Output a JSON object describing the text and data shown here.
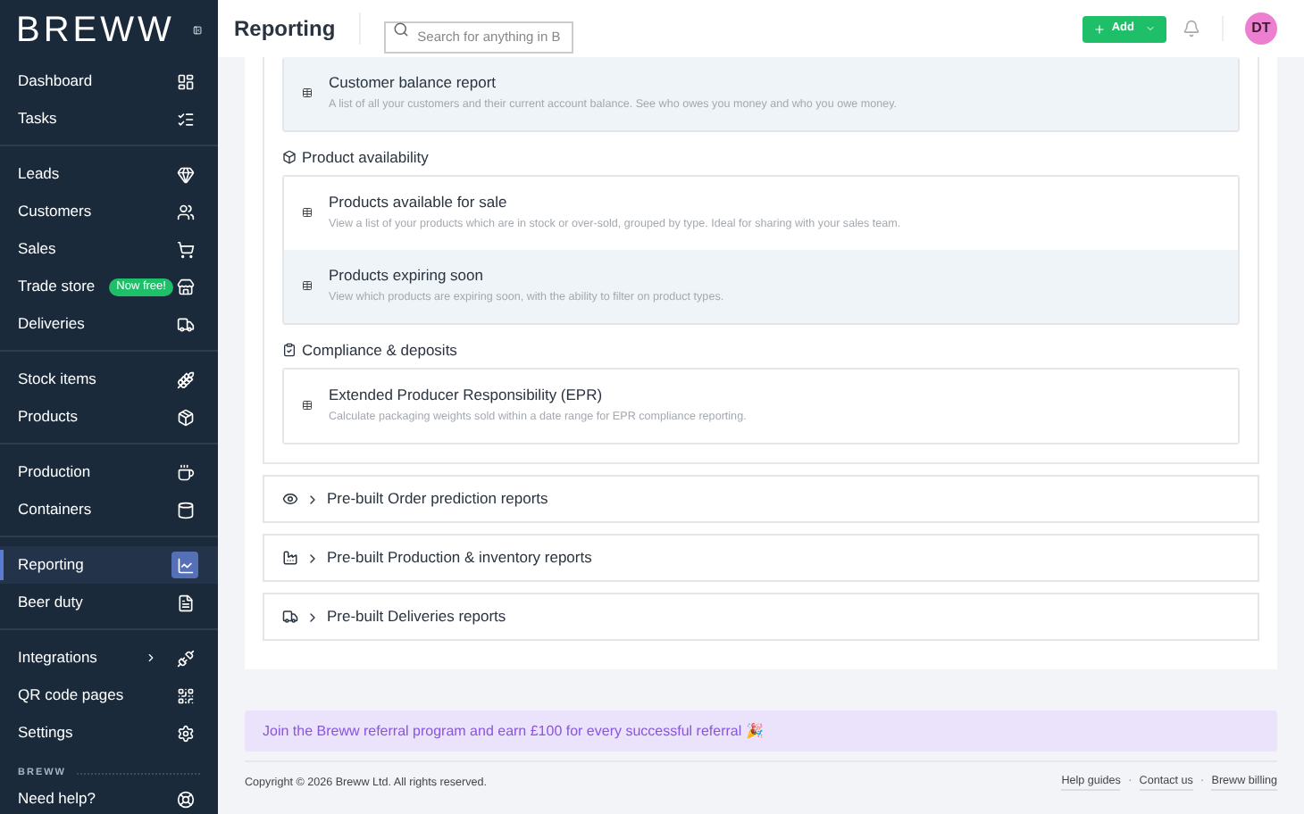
{
  "sidebar": {
    "logo": "BREWW",
    "groups": [
      [
        {
          "label": "Dashboard",
          "selected": false
        },
        {
          "label": "Tasks",
          "selected": false
        }
      ],
      [
        {
          "label": "Leads",
          "selected": false
        },
        {
          "label": "Customers",
          "selected": false
        },
        {
          "label": "Sales",
          "selected": false
        },
        {
          "label": "Trade store",
          "badge": "Now free!",
          "selected": false
        },
        {
          "label": "Deliveries",
          "selected": false
        }
      ],
      [
        {
          "label": "Stock items",
          "selected": false
        },
        {
          "label": "Products",
          "selected": false
        }
      ],
      [
        {
          "label": "Production",
          "selected": false
        },
        {
          "label": "Containers",
          "selected": false
        }
      ],
      [
        {
          "label": "Reporting",
          "selected": true
        },
        {
          "label": "Beer duty",
          "selected": false
        }
      ],
      [
        {
          "label": "Integrations",
          "submenu": true,
          "selected": false
        },
        {
          "label": "QR code pages",
          "selected": false
        },
        {
          "label": "Settings",
          "selected": false
        }
      ]
    ],
    "section_label": "BREWW",
    "help": "Need help?"
  },
  "header": {
    "title": "Reporting",
    "search": {
      "placeholder": "Search for anything in B"
    },
    "add_button": "Add",
    "avatar": "DT"
  },
  "sections": [
    {
      "reports": [
        {
          "title": "Customer balance report",
          "description": "A list of all your customers and their current account balance. See who owes you money and who you owe money.",
          "shaded": true
        }
      ]
    },
    {
      "title": "Product availability",
      "reports": [
        {
          "title": "Products available for sale",
          "description": "View a list of your products which are in stock or over-sold, grouped by type. Ideal for sharing with your sales team.",
          "shaded": false
        },
        {
          "title": "Products expiring soon",
          "description": "View which products are expiring soon, with the ability to filter on product types.",
          "shaded": true
        }
      ]
    },
    {
      "title": "Compliance & deposits",
      "reports": [
        {
          "title": "Extended Producer Responsibility (EPR)",
          "description": "Calculate packaging weights sold within a date range for EPR compliance reporting.",
          "shaded": false
        }
      ]
    }
  ],
  "accordions": [
    {
      "label": "Pre-built Order prediction reports",
      "expanded": false
    },
    {
      "label": "Pre-built Production & inventory reports",
      "expanded": false
    },
    {
      "label": "Pre-built Deliveries reports",
      "expanded": false
    }
  ],
  "referral": "Join the Breww referral program and earn £100 for every successful referral 🎉",
  "footer": {
    "copyright": "Copyright © 2026 Breww Ltd. All rights reserved.",
    "links": [
      "Help guides",
      "Contact us",
      "Breww billing"
    ],
    "separators": [
      "·",
      "·"
    ]
  }
}
